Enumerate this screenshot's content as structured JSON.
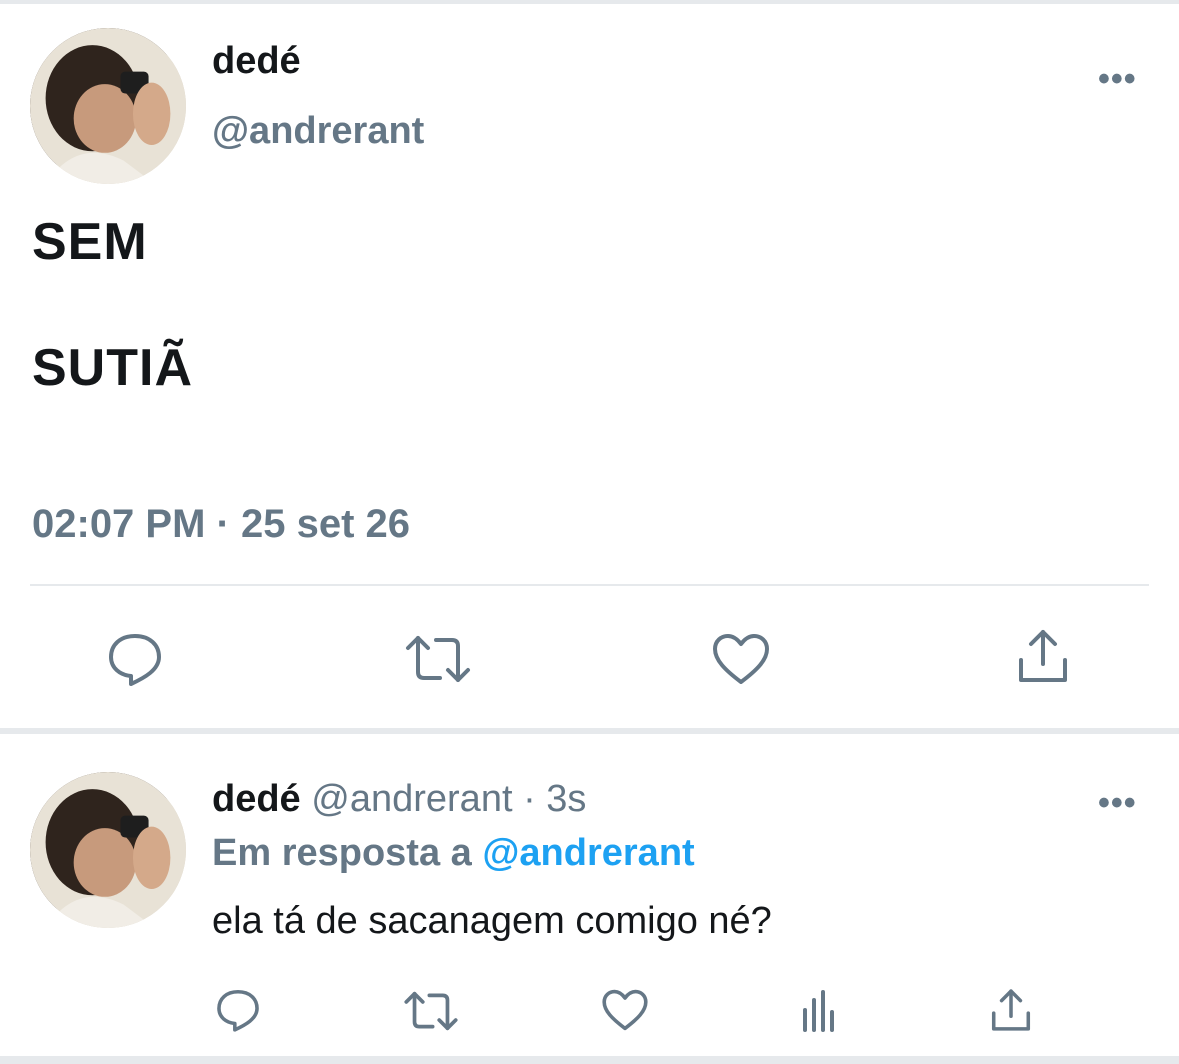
{
  "tweet": {
    "name": "dedé",
    "handle": "@andrerant",
    "lines": [
      "SEM",
      "SUTIÃ"
    ],
    "timestamp": "02:07 PM · 25 set 26",
    "actions": [
      "reply-icon",
      "retweet-icon",
      "like-icon",
      "share-icon"
    ]
  },
  "reply": {
    "name": "dedé",
    "handle": "@andrerant",
    "separator": "·",
    "age": "3s",
    "in_reply_prefix": "Em resposta a",
    "in_reply_mention": "@andrerant",
    "text": "ela tá de sacanagem comigo né?",
    "actions": [
      "reply-icon",
      "retweet-icon",
      "like-icon",
      "analytics-icon",
      "share-icon"
    ]
  },
  "more_glyph": "•••",
  "colors": {
    "text": "#14171a",
    "secondary": "#657786",
    "link": "#1da1f2",
    "divider": "#e6e9ec"
  }
}
